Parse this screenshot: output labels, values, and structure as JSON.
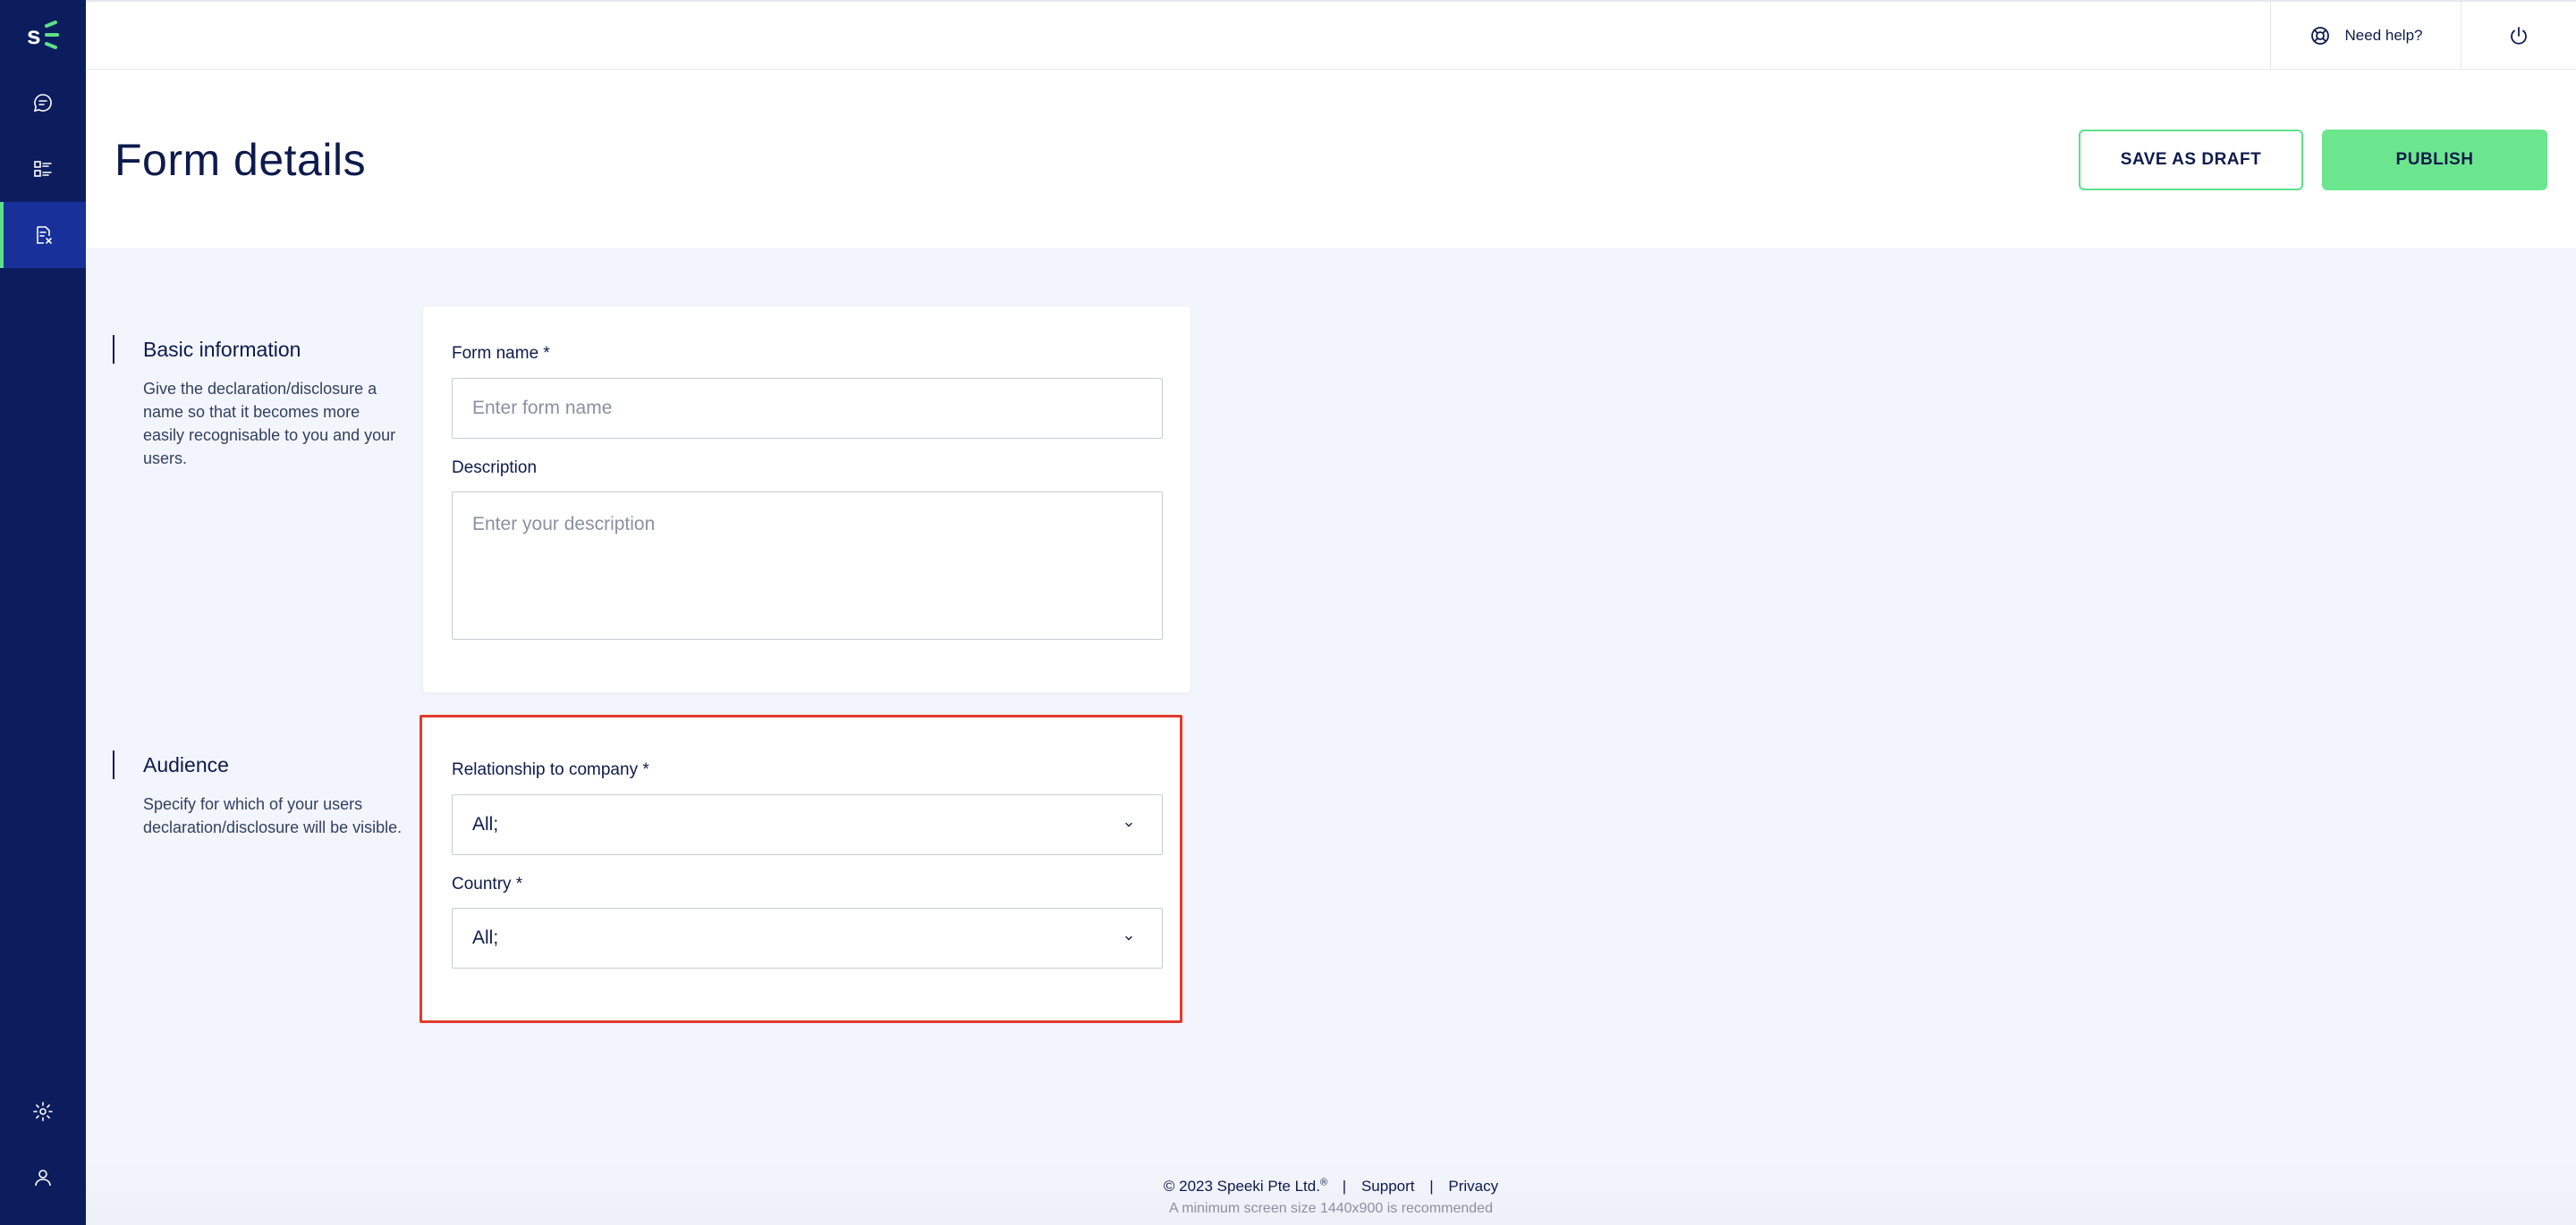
{
  "sidebar": {
    "logo": "s-logo",
    "items": [
      {
        "icon": "chat-bubble-icon"
      },
      {
        "icon": "checklist-icon"
      },
      {
        "icon": "form-edit-icon",
        "active": true
      },
      {
        "icon": "gear-icon"
      },
      {
        "icon": "user-icon"
      }
    ]
  },
  "topbar": {
    "help_label": "Need help?",
    "help_icon": "lifebuoy-icon",
    "power_icon": "power-icon"
  },
  "header": {
    "title": "Form details",
    "save_draft_label": "SAVE AS DRAFT",
    "publish_label": "PUBLISH"
  },
  "basic_info": {
    "title": "Basic information",
    "description": "Give the declaration/disclosure a name so that it becomes more easily recognisable to you and your users.",
    "form_name_label": "Form name *",
    "form_name_placeholder": "Enter form name",
    "description_label": "Description",
    "description_placeholder": "Enter your description"
  },
  "audience": {
    "title": "Audience",
    "description": "Specify for which of your users declaration/disclosure will be visible.",
    "relationship_label": "Relationship to company *",
    "relationship_value": "All;",
    "country_label": "Country *",
    "country_value": "All;"
  },
  "footer": {
    "copyright": "© 2023 Speeki Pte Ltd.",
    "registered": "®",
    "separator": "|",
    "support": "Support",
    "privacy": "Privacy",
    "note": "A minimum screen size 1440x900 is recommended"
  },
  "colors": {
    "sidebar": "#0c1d5e",
    "accent_green": "#6be68f",
    "highlight_red": "#e23a2e"
  }
}
